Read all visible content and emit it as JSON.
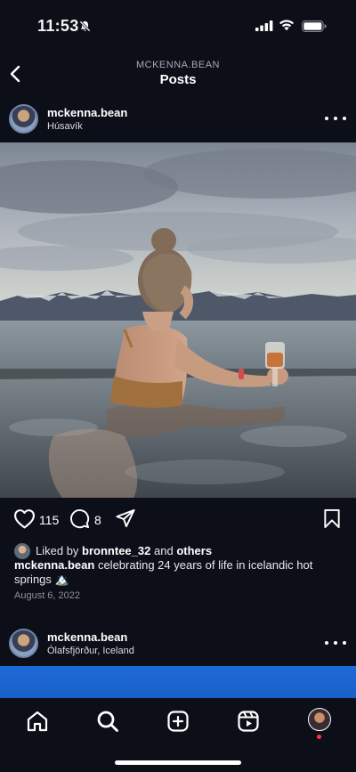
{
  "status_bar": {
    "time": "11:53"
  },
  "header": {
    "username": "MCKENNA.BEAN",
    "title": "Posts"
  },
  "post": {
    "username": "mckenna.bean",
    "location": "Húsavík",
    "likes_count": "115",
    "comments_count": "8",
    "liked_by_prefix": "Liked by",
    "liked_by_user": "bronntee_32",
    "liked_by_and": "and",
    "liked_by_others": "others",
    "caption_username": "mckenna.bean",
    "caption_text": "celebrating 24 years of life in icelandic hot springs 🏔️",
    "date": "August 6, 2022"
  },
  "next_post": {
    "username": "mckenna.bean",
    "location": "Ólafsfjörður, Iceland"
  },
  "icons": {
    "back": "chevron-left-icon",
    "more": "ellipsis-icon",
    "like": "heart-icon",
    "comment": "comment-icon",
    "share": "send-icon",
    "save": "bookmark-icon",
    "home": "home-icon",
    "search": "search-icon",
    "create": "plus-square-icon",
    "reels": "reels-icon"
  },
  "colors": {
    "background": "#0c0f18",
    "notification_dot": "#ff2e4d"
  }
}
